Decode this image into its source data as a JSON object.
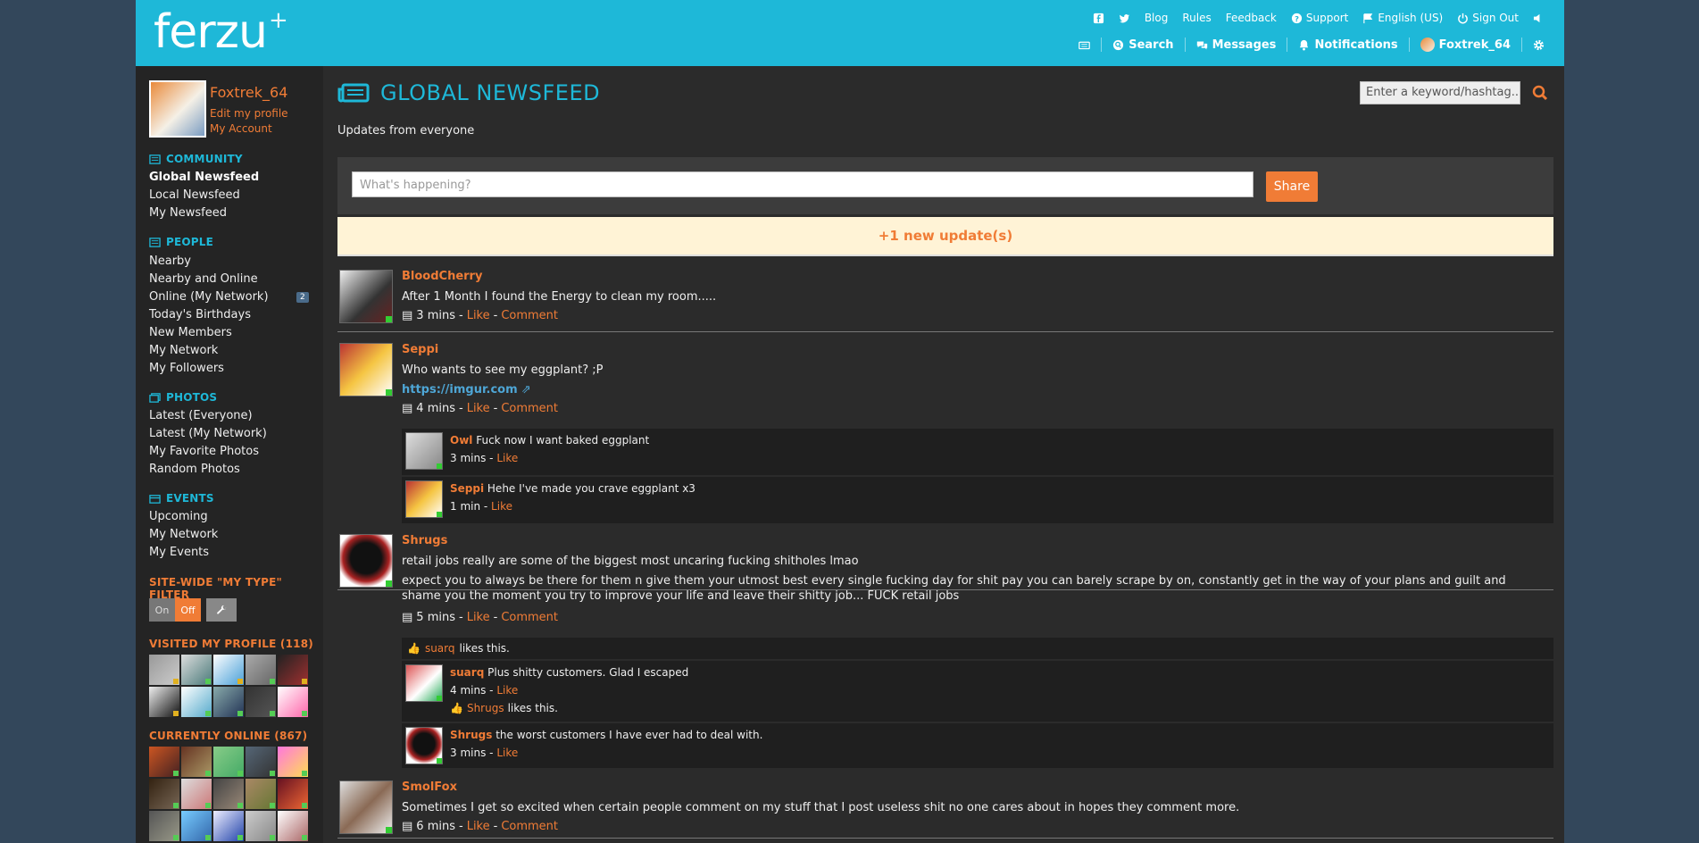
{
  "brand": {
    "name": "ferzu",
    "plus": "+"
  },
  "toplinks": {
    "blog": "Blog",
    "rules": "Rules",
    "feedback": "Feedback",
    "support": "Support",
    "language": "English (US)",
    "signout": "Sign Out"
  },
  "nav": {
    "search": "Search",
    "messages": "Messages",
    "notifications": "Notifications",
    "user": "Foxtrek_64"
  },
  "sidebar": {
    "username": "Foxtrek_64",
    "edit_profile": "Edit my profile",
    "my_account": "My Account",
    "community": {
      "title": "COMMUNITY",
      "items": [
        "Global Newsfeed",
        "Local Newsfeed",
        "My Newsfeed"
      ]
    },
    "people": {
      "title": "PEOPLE",
      "items": [
        "Nearby",
        "Nearby and Online",
        "Online (My Network)",
        "Today's Birthdays",
        "New Members",
        "My Network",
        "My Followers"
      ],
      "online_badge": "2"
    },
    "photos": {
      "title": "PHOTOS",
      "items": [
        "Latest (Everyone)",
        "Latest (My Network)",
        "My Favorite Photos",
        "Random Photos"
      ]
    },
    "events": {
      "title": "EVENTS",
      "items": [
        "Upcoming",
        "My Network",
        "My Events"
      ]
    },
    "filter": {
      "title": "SITE-WIDE \"MY TYPE\" FILTER",
      "on": "On",
      "off": "Off"
    },
    "visited": {
      "title": "VISITED MY PROFILE (118)"
    },
    "online": {
      "title": "CURRENTLY ONLINE (867)"
    }
  },
  "main": {
    "title": "GLOBAL NEWSFEED",
    "subtitle": "Updates from everyone",
    "search_placeholder": "Enter a keyword/hashtag...",
    "composer_placeholder": "What's happening?",
    "share_label": "Share",
    "new_updates": "+1 new update(s)"
  },
  "posts": [
    {
      "name": "BloodCherry",
      "text": "After 1 Month I found the Energy to clean my room.....",
      "time": "3 mins",
      "like": "Like",
      "comment": "Comment"
    },
    {
      "name": "Seppi",
      "text": "Who wants to see my eggplant? ;P",
      "link": "https://imgur.com",
      "time": "4 mins",
      "like": "Like",
      "comment": "Comment",
      "comments": [
        {
          "name": "Owl",
          "text": "Fuck now I want baked eggplant",
          "time": "3 mins",
          "like": "Like"
        },
        {
          "name": "Seppi",
          "text": "Hehe I've made you crave eggplant x3",
          "time": "1 min",
          "like": "Like"
        }
      ]
    },
    {
      "name": "Shrugs",
      "text": "retail jobs really are some of the biggest most uncaring fucking shitholes lmao",
      "text2": "expect you to always be there for them n give them your utmost best every single fucking day for shit pay you can barely scrape by on, constantly get in the way of your plans and guilt and shame you the moment you try to improve your life and leave their shitty job... FUCK retail jobs",
      "time": "5 mins",
      "like": "Like",
      "comment": "Comment",
      "liked_by": "suarq",
      "likes_text": "likes this.",
      "comments": [
        {
          "name": "suarq",
          "text": "Plus shitty customers. Glad I escaped",
          "time": "4 mins",
          "like": "Like",
          "liked_by": "Shrugs",
          "likes_text": "likes this."
        },
        {
          "name": "Shrugs",
          "text": "the worst customers I have ever had to deal with.",
          "time": "3 mins",
          "like": "Like"
        }
      ]
    },
    {
      "name": "SmolFox",
      "text": "Sometimes I get so excited when certain people comment on my stuff that I post useless shit no one cares about in hopes they comment more.",
      "time": "6 mins",
      "like": "Like",
      "comment": "Comment"
    }
  ],
  "colors": {
    "header": "#1eb8d8",
    "accent": "#f07c36",
    "sidebar": "#242424",
    "main": "#2b2b2b"
  }
}
